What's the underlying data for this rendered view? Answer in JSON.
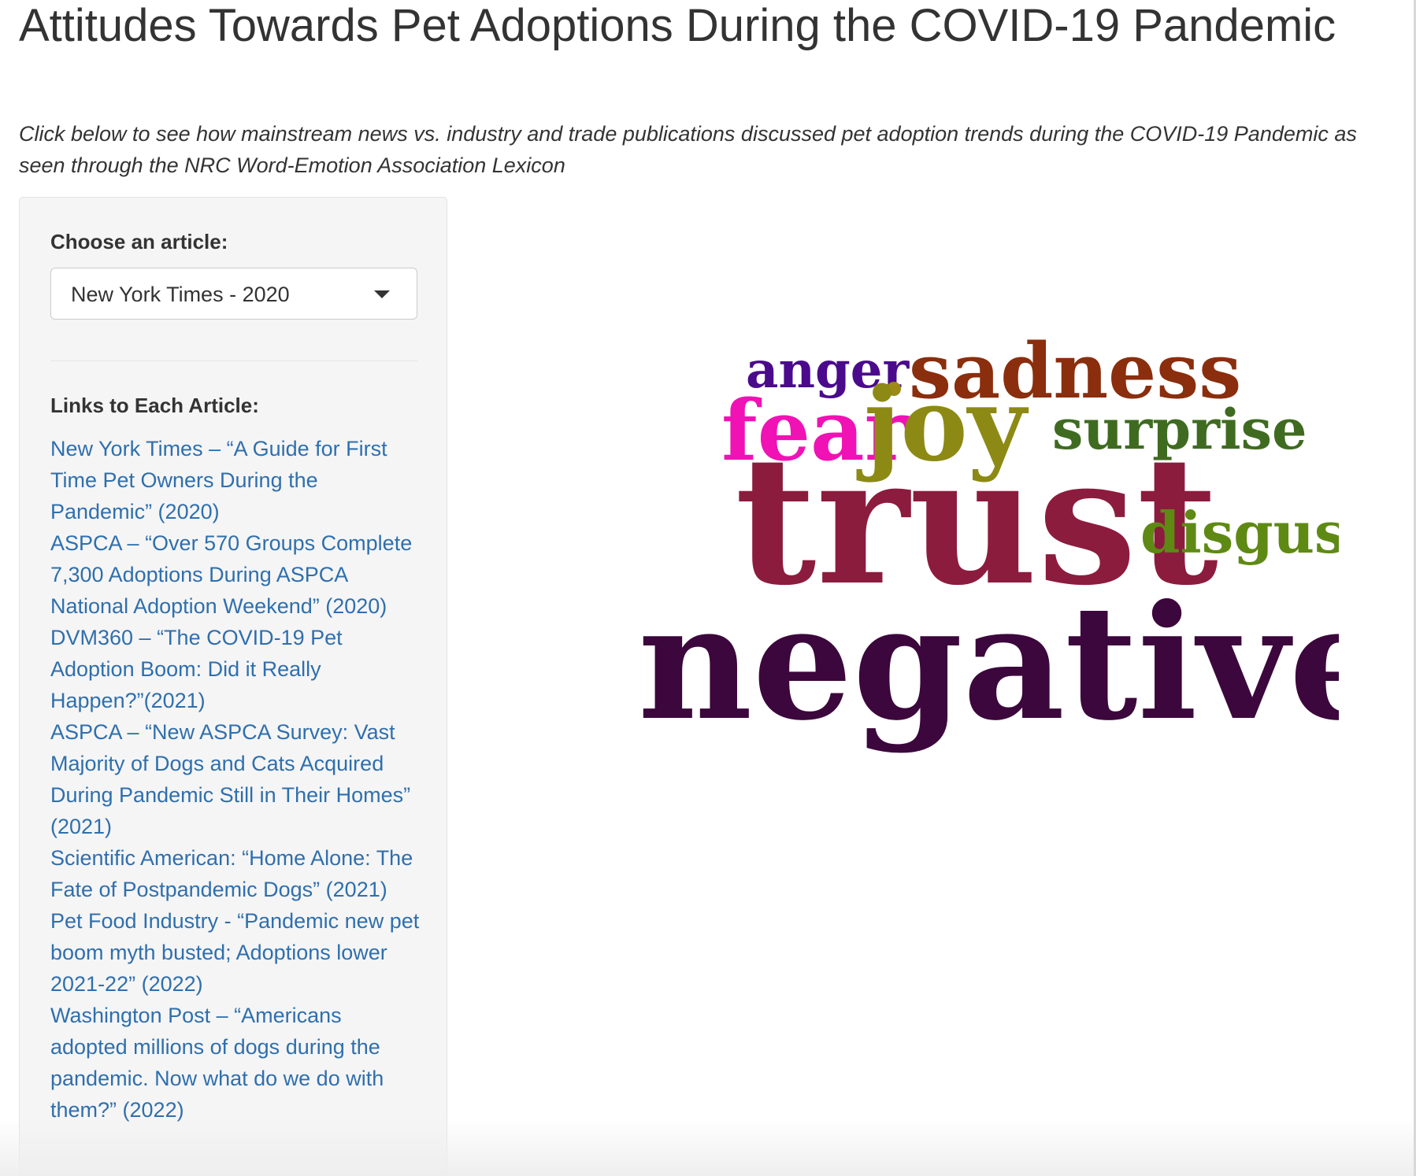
{
  "header": {
    "title": "Attitudes Towards Pet Adoptions During the COVID-19 Pandemic",
    "subtitle": "Click below to see how mainstream news vs. industry and trade publications discussed pet adoption trends during the COVID-19 Pandemic as seen through the NRC Word-Emotion Association Lexicon"
  },
  "sidebar": {
    "choose_label": "Choose an article:",
    "select": {
      "selected_value": "New York Times - 2020",
      "icon": "chevron-down-icon"
    },
    "links_heading": "Links to Each Article:",
    "links": [
      "New York Times – “A Guide for First Time Pet Owners During the Pandemic” (2020)",
      "ASPCA – “Over 570 Groups Complete 7,300 Adoptions During ASPCA National Adoption Weekend” (2020)",
      "DVM360 – “The COVID-19 Pet Adoption Boom: Did it Really Happen?”(2021)",
      "ASPCA – “New ASPCA Survey: Vast Majority of Dogs and Cats Acquired During Pandemic Still in Their Homes” (2021)",
      "Scientific American: “Home Alone: The Fate of Postpandemic Dogs” (2021)",
      "Pet Food Industry - “Pandemic new pet boom myth busted; Adoptions lower 2021-22” (2022)",
      "Washington Post – “Americans adopted millions of dogs during the pandemic. Now what do we do with them?” (2022)"
    ],
    "link_color": "#2f6fad"
  },
  "wordcloud": {
    "words": [
      {
        "text": "anger",
        "color": "#4b0a8c"
      },
      {
        "text": "sadness",
        "color": "#8a2e0d"
      },
      {
        "text": "fear",
        "color": "#f012b4"
      },
      {
        "text": "joy",
        "color": "#8c8a14"
      },
      {
        "text": "surprise",
        "color": "#3f6b21"
      },
      {
        "text": "trust",
        "color": "#8c1c3e"
      },
      {
        "text": "disgust",
        "color": "#5e8a14"
      },
      {
        "text": "negative",
        "color": "#3c073c"
      }
    ],
    "dot_color": "#9c8a16"
  }
}
